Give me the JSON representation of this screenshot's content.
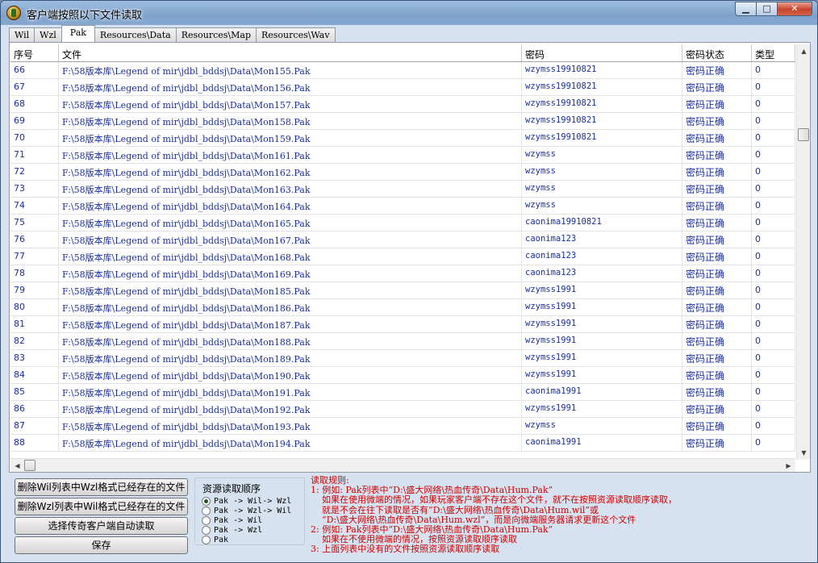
{
  "window": {
    "title": "客户端按照以下文件读取",
    "minimize_glyph": "▁",
    "maximize_glyph": "□",
    "close_glyph": "✕"
  },
  "tabs": [
    "Wil",
    "Wzl",
    "Pak",
    "Resources\\Data",
    "Resources\\Map",
    "Resources\\Wav"
  ],
  "active_tab": "Pak",
  "table": {
    "headers": [
      "序号",
      "文件",
      "密码",
      "密码状态",
      "类型"
    ],
    "rows": [
      {
        "no": "66",
        "path": "F:\\58版本库\\Legend of mir\\jdbl_bddsj\\Data\\Mon155.Pak",
        "pw": "wzymss19910821",
        "status": "密码正确",
        "type": "0"
      },
      {
        "no": "67",
        "path": "F:\\58版本库\\Legend of mir\\jdbl_bddsj\\Data\\Mon156.Pak",
        "pw": "wzymss19910821",
        "status": "密码正确",
        "type": "0"
      },
      {
        "no": "68",
        "path": "F:\\58版本库\\Legend of mir\\jdbl_bddsj\\Data\\Mon157.Pak",
        "pw": "wzymss19910821",
        "status": "密码正确",
        "type": "0"
      },
      {
        "no": "69",
        "path": "F:\\58版本库\\Legend of mir\\jdbl_bddsj\\Data\\Mon158.Pak",
        "pw": "wzymss19910821",
        "status": "密码正确",
        "type": "0"
      },
      {
        "no": "70",
        "path": "F:\\58版本库\\Legend of mir\\jdbl_bddsj\\Data\\Mon159.Pak",
        "pw": "wzymss19910821",
        "status": "密码正确",
        "type": "0"
      },
      {
        "no": "71",
        "path": "F:\\58版本库\\Legend of mir\\jdbl_bddsj\\Data\\Mon161.Pak",
        "pw": "wzymss",
        "status": "密码正确",
        "type": "0"
      },
      {
        "no": "72",
        "path": "F:\\58版本库\\Legend of mir\\jdbl_bddsj\\Data\\Mon162.Pak",
        "pw": "wzymss",
        "status": "密码正确",
        "type": "0"
      },
      {
        "no": "73",
        "path": "F:\\58版本库\\Legend of mir\\jdbl_bddsj\\Data\\Mon163.Pak",
        "pw": "wzymss",
        "status": "密码正确",
        "type": "0"
      },
      {
        "no": "74",
        "path": "F:\\58版本库\\Legend of mir\\jdbl_bddsj\\Data\\Mon164.Pak",
        "pw": "wzymss",
        "status": "密码正确",
        "type": "0"
      },
      {
        "no": "75",
        "path": "F:\\58版本库\\Legend of mir\\jdbl_bddsj\\Data\\Mon165.Pak",
        "pw": "caonima19910821",
        "status": "密码正确",
        "type": "0"
      },
      {
        "no": "76",
        "path": "F:\\58版本库\\Legend of mir\\jdbl_bddsj\\Data\\Mon167.Pak",
        "pw": "caonima123",
        "status": "密码正确",
        "type": "0"
      },
      {
        "no": "77",
        "path": "F:\\58版本库\\Legend of mir\\jdbl_bddsj\\Data\\Mon168.Pak",
        "pw": "caonima123",
        "status": "密码正确",
        "type": "0"
      },
      {
        "no": "78",
        "path": "F:\\58版本库\\Legend of mir\\jdbl_bddsj\\Data\\Mon169.Pak",
        "pw": "caonima123",
        "status": "密码正确",
        "type": "0"
      },
      {
        "no": "79",
        "path": "F:\\58版本库\\Legend of mir\\jdbl_bddsj\\Data\\Mon185.Pak",
        "pw": "wzymss1991",
        "status": "密码正确",
        "type": "0"
      },
      {
        "no": "80",
        "path": "F:\\58版本库\\Legend of mir\\jdbl_bddsj\\Data\\Mon186.Pak",
        "pw": "wzymss1991",
        "status": "密码正确",
        "type": "0"
      },
      {
        "no": "81",
        "path": "F:\\58版本库\\Legend of mir\\jdbl_bddsj\\Data\\Mon187.Pak",
        "pw": "wzymss1991",
        "status": "密码正确",
        "type": "0"
      },
      {
        "no": "82",
        "path": "F:\\58版本库\\Legend of mir\\jdbl_bddsj\\Data\\Mon188.Pak",
        "pw": "wzymss1991",
        "status": "密码正确",
        "type": "0"
      },
      {
        "no": "83",
        "path": "F:\\58版本库\\Legend of mir\\jdbl_bddsj\\Data\\Mon189.Pak",
        "pw": "wzymss1991",
        "status": "密码正确",
        "type": "0"
      },
      {
        "no": "84",
        "path": "F:\\58版本库\\Legend of mir\\jdbl_bddsj\\Data\\Mon190.Pak",
        "pw": "wzymss1991",
        "status": "密码正确",
        "type": "0"
      },
      {
        "no": "85",
        "path": "F:\\58版本库\\Legend of mir\\jdbl_bddsj\\Data\\Mon191.Pak",
        "pw": "caonima1991",
        "status": "密码正确",
        "type": "0"
      },
      {
        "no": "86",
        "path": "F:\\58版本库\\Legend of mir\\jdbl_bddsj\\Data\\Mon192.Pak",
        "pw": "wzymss1991",
        "status": "密码正确",
        "type": "0"
      },
      {
        "no": "87",
        "path": "F:\\58版本库\\Legend of mir\\jdbl_bddsj\\Data\\Mon193.Pak",
        "pw": "wzymss",
        "status": "密码正确",
        "type": "0"
      },
      {
        "no": "88",
        "path": "F:\\58版本库\\Legend of mir\\jdbl_bddsj\\Data\\Mon194.Pak",
        "pw": "caonima1991",
        "status": "密码正确",
        "type": "0"
      }
    ]
  },
  "buttons": {
    "delete_wil": "删除Wil列表中Wzl格式已经存在的文件",
    "delete_wzl": "删除Wzl列表中Wil格式已经存在的文件",
    "select_client": "选择传奇客户端自动读取",
    "save": "保存"
  },
  "read_order": {
    "title": "资源读取顺序",
    "options": [
      "Pak -> Wil-> Wzl",
      "Pak -> Wzl-> Wil",
      "Pak -> Wil",
      "Pak -> Wzl",
      "Pak"
    ],
    "selected_index": 0
  },
  "rules": {
    "lines": [
      "读取规则:",
      "1: 例如: Pak列表中“D:\\盛大网络\\热血传奇\\Data\\Hum.Pak”",
      "    如果在使用微端的情况，如果玩家客户端不存在这个文件，就不在按照资源读取顺序读取，",
      "    就是不会在往下读取是否有“D:\\盛大网络\\热血传奇\\Data\\Hum.wil”或",
      "    “D:\\盛大网络\\热血传奇\\Data\\Hum.wzl”，而是向微端服务器请求更新这个文件",
      "2: 例如: Pak列表中“D:\\盛大网络\\热血传奇\\Data\\Hum.Pak”",
      "    如果在不使用微端的情况，按照资源读取顺序读取",
      "3: 上面列表中没有的文件按照资源读取顺序读取"
    ]
  },
  "colors": {
    "link_text": "#1a2fa0",
    "rules_text": "#d40000"
  }
}
